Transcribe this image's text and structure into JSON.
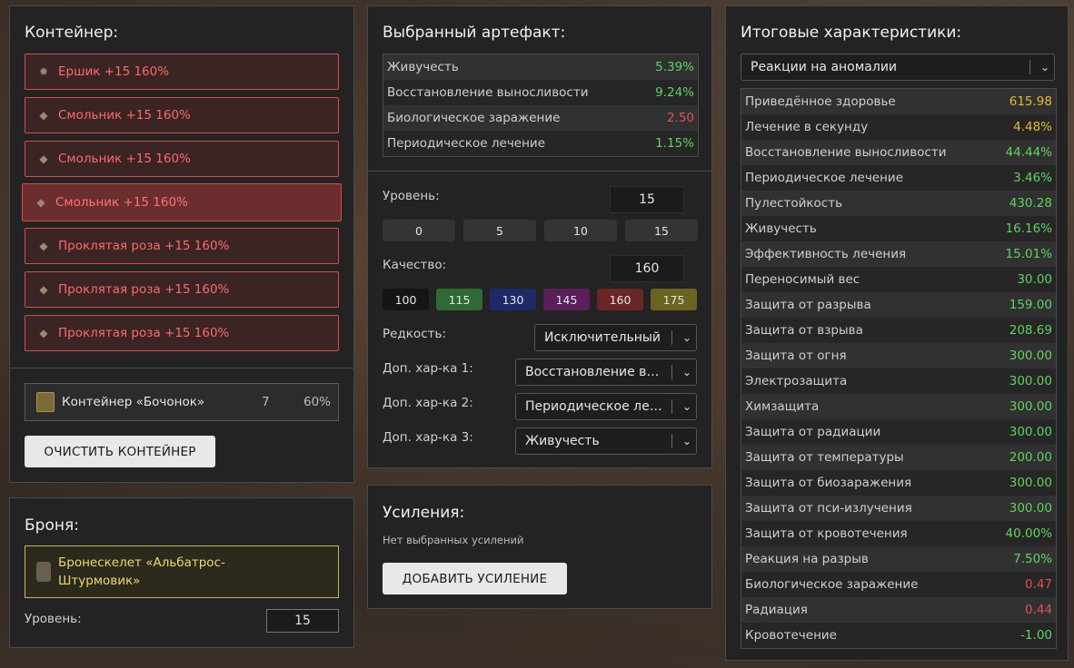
{
  "container": {
    "title": "Контейнер:",
    "items": [
      {
        "icon": "star-icon",
        "label": "Ершик +15 160%"
      },
      {
        "icon": "artifact-icon",
        "label": "Смольник +15 160%"
      },
      {
        "icon": "artifact-icon",
        "label": "Смольник +15 160%"
      },
      {
        "icon": "artifact-icon",
        "label": "Смольник +15 160%",
        "active": true
      },
      {
        "icon": "artifact-icon",
        "label": "Проклятая роза +15 160%"
      },
      {
        "icon": "artifact-icon",
        "label": "Проклятая роза +15 160%"
      },
      {
        "icon": "artifact-icon",
        "label": "Проклятая роза +15 160%"
      }
    ],
    "barrel": {
      "label": "Контейнер «Бочонок»",
      "count": "7",
      "percent": "60%"
    },
    "clear_button": "ОЧИСТИТЬ КОНТЕЙНЕР"
  },
  "armor": {
    "title": "Броня:",
    "name": "Бронескелет «Альбатрос-Штурмовик»",
    "level_label": "Уровень:",
    "level_value": "15"
  },
  "selected": {
    "title": "Выбранный артефакт:",
    "stats": [
      {
        "name": "Живучесть",
        "value": "5.39%",
        "color": "g"
      },
      {
        "name": "Восстановление выносливости",
        "value": "9.24%",
        "color": "g"
      },
      {
        "name": "Биологическое заражение",
        "value": "2.50",
        "color": "r"
      },
      {
        "name": "Периодическое лечение",
        "value": "1.15%",
        "color": "g"
      }
    ],
    "level_label": "Уровень:",
    "level_value": "15",
    "level_presets": [
      "0",
      "5",
      "10",
      "15"
    ],
    "quality_label": "Качество:",
    "quality_value": "160",
    "quality_presets": [
      {
        "label": "100",
        "color": "#151515"
      },
      {
        "label": "115",
        "color": "#2f6a34"
      },
      {
        "label": "130",
        "color": "#1e2a68"
      },
      {
        "label": "145",
        "color": "#5a1f5a"
      },
      {
        "label": "160",
        "color": "#6a2626"
      },
      {
        "label": "175",
        "color": "#6a6420"
      }
    ],
    "rarity_label": "Редкость:",
    "rarity_value": "Исключительный",
    "extra1_label": "Доп. хар-ка 1:",
    "extra1_value": "Восстановление выносливости",
    "extra2_label": "Доп. хар-ка 2:",
    "extra2_value": "Периодическое лечение",
    "extra3_label": "Доп. хар-ка 3:",
    "extra3_value": "Живучесть"
  },
  "boosts": {
    "title": "Усиления:",
    "empty_text": "Нет выбранных усилений",
    "add_button": "ДОБАВИТЬ УСИЛЕНИЕ"
  },
  "totals": {
    "title": "Итоговые характеристики:",
    "filter_value": "Реакции на аномалии",
    "stats": [
      {
        "name": "Приведённое здоровье",
        "value": "615.98",
        "color": "y"
      },
      {
        "name": "Лечение в секунду",
        "value": "4.48%",
        "color": "y"
      },
      {
        "name": "Восстановление выносливости",
        "value": "44.44%",
        "color": "g"
      },
      {
        "name": "Периодическое лечение",
        "value": "3.46%",
        "color": "g"
      },
      {
        "name": "Пулестойкость",
        "value": "430.28",
        "color": "g"
      },
      {
        "name": "Живучесть",
        "value": "16.16%",
        "color": "g"
      },
      {
        "name": "Эффективность лечения",
        "value": "15.01%",
        "color": "g"
      },
      {
        "name": "Переносимый вес",
        "value": "30.00",
        "color": "g"
      },
      {
        "name": "Защита от разрыва",
        "value": "159.00",
        "color": "g"
      },
      {
        "name": "Защита от взрыва",
        "value": "208.69",
        "color": "g"
      },
      {
        "name": "Защита от огня",
        "value": "300.00",
        "color": "g"
      },
      {
        "name": "Электрозащита",
        "value": "300.00",
        "color": "g"
      },
      {
        "name": "Химзащита",
        "value": "300.00",
        "color": "g"
      },
      {
        "name": "Защита от радиации",
        "value": "300.00",
        "color": "g"
      },
      {
        "name": "Защита от температуры",
        "value": "200.00",
        "color": "g"
      },
      {
        "name": "Защита от биозаражения",
        "value": "300.00",
        "color": "g"
      },
      {
        "name": "Защита от пси-излучения",
        "value": "300.00",
        "color": "g"
      },
      {
        "name": "Защита от кровотечения",
        "value": "40.00%",
        "color": "g"
      },
      {
        "name": "Реакция на разрыв",
        "value": "7.50%",
        "color": "g"
      },
      {
        "name": "Биологическое заражение",
        "value": "0.47",
        "color": "r"
      },
      {
        "name": "Радиация",
        "value": "0.44",
        "color": "r"
      },
      {
        "name": "Кровотечение",
        "value": "-1.00",
        "color": "g"
      }
    ]
  }
}
